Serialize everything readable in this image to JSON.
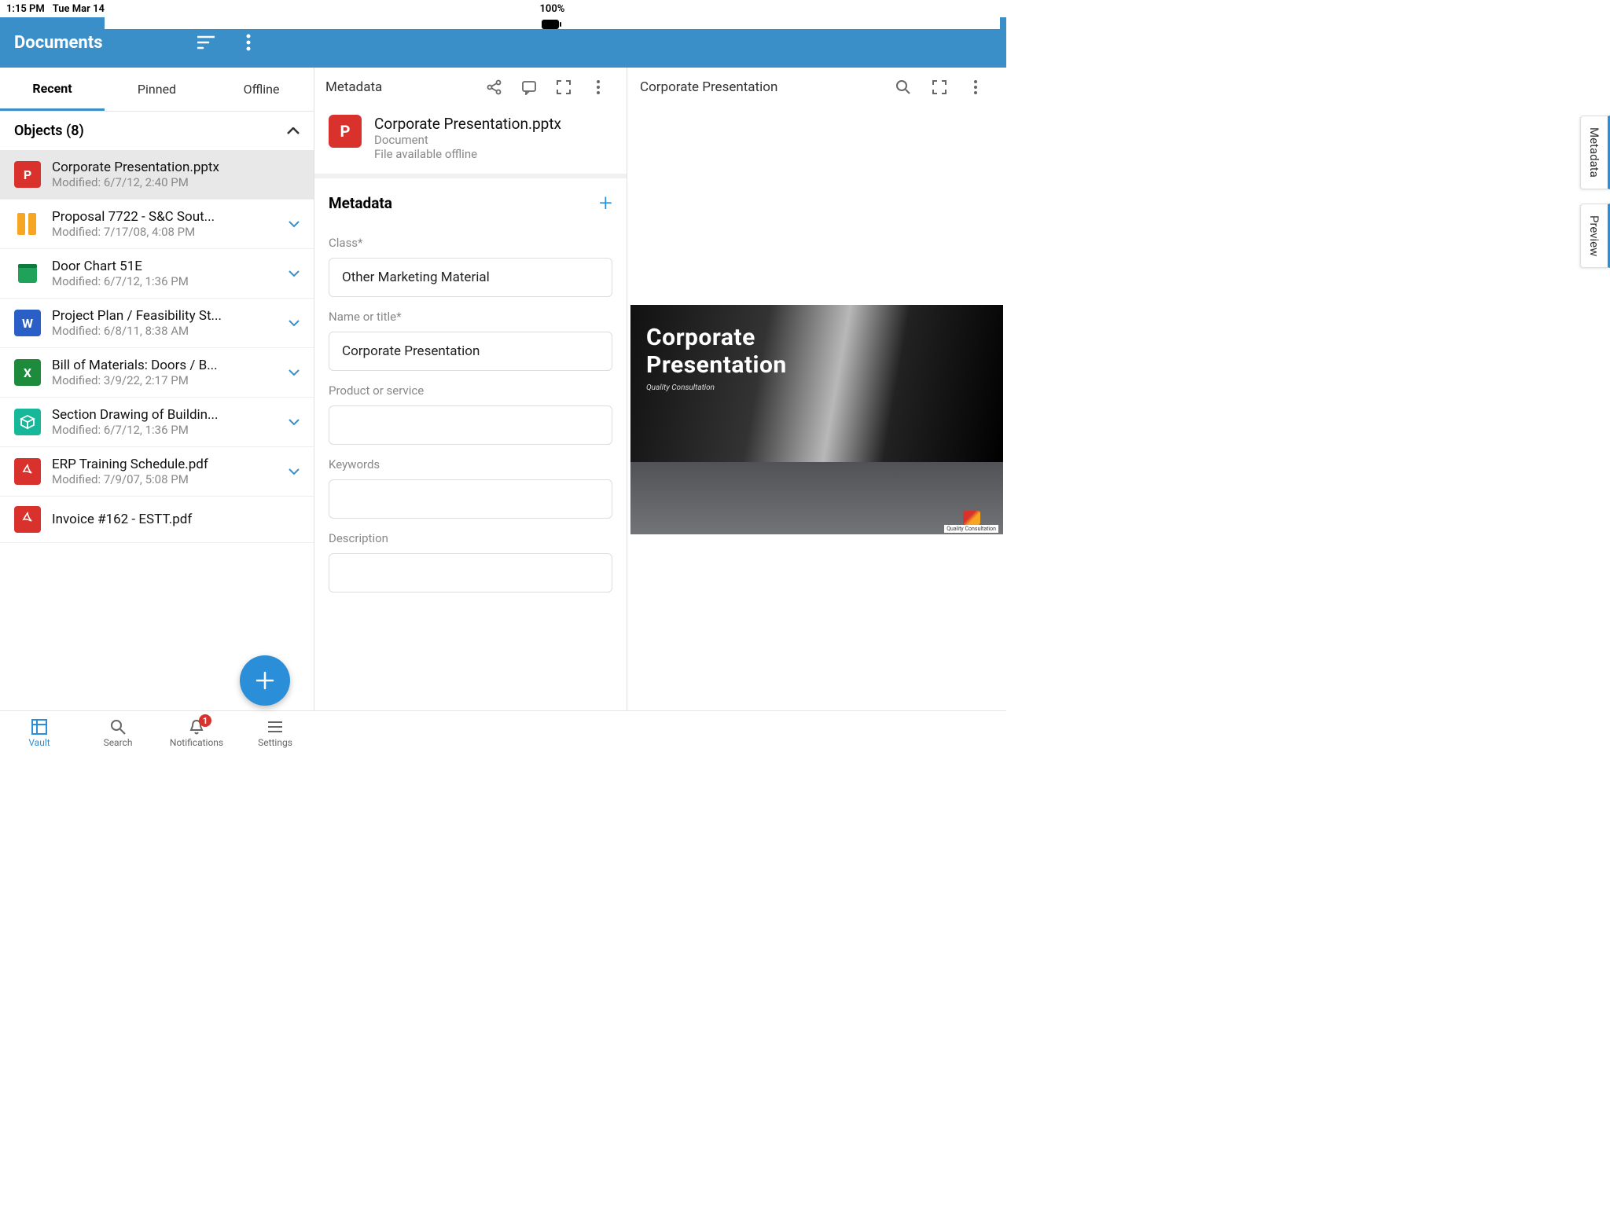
{
  "statusbar": {
    "time": "1:15 PM",
    "date": "Tue Mar 14",
    "battery": "100%"
  },
  "topbar": {
    "title": "Documents"
  },
  "tabs": {
    "recent": "Recent",
    "pinned": "Pinned",
    "offline": "Offline"
  },
  "section": {
    "label": "Objects (8)"
  },
  "items": [
    {
      "name": "Corporate Presentation.pptx",
      "sub": "Modified: 6/7/12, 2:40 PM",
      "icon": "P",
      "color": "#d9322d",
      "selected": true,
      "chev": false
    },
    {
      "name": "Proposal 7722 - S&C Sout...",
      "sub": "Modified: 7/17/08, 4:08 PM",
      "icon": "binder",
      "color": "#f6a623",
      "chev": true
    },
    {
      "name": "Door Chart 51E",
      "sub": "Modified: 6/7/12, 1:36 PM",
      "icon": "book",
      "color": "#1fa35a",
      "chev": true
    },
    {
      "name": "Project Plan / Feasibility St...",
      "sub": "Modified: 6/8/11, 8:38 AM",
      "icon": "W",
      "color": "#2a5fc8",
      "chev": true
    },
    {
      "name": "Bill of Materials: Doors / B...",
      "sub": "Modified: 3/9/22, 2:17 PM",
      "icon": "X",
      "color": "#1d8a3c",
      "chev": true
    },
    {
      "name": "Section Drawing of Buildin...",
      "sub": "Modified: 6/7/12, 1:36 PM",
      "icon": "box",
      "color": "#17b79a",
      "chev": true
    },
    {
      "name": "ERP Training Schedule.pdf",
      "sub": "Modified: 7/9/07, 5:08 PM",
      "icon": "pdf",
      "color": "#d9322d",
      "chev": true
    },
    {
      "name": "Invoice #162 - ESTT.pdf",
      "sub": "",
      "icon": "pdf",
      "color": "#d9322d",
      "chev": false
    }
  ],
  "middle": {
    "toplabel": "Metadata",
    "file": {
      "title": "Corporate Presentation.pptx",
      "type": "Document",
      "status": "File available offline"
    },
    "section_title": "Metadata",
    "fields": {
      "class_label": "Class*",
      "class_value": "Other Marketing Material",
      "name_label": "Name or title*",
      "name_value": "Corporate Presentation",
      "product_label": "Product or service",
      "product_value": "",
      "keywords_label": "Keywords",
      "keywords_value": "",
      "description_label": "Description",
      "description_value": ""
    }
  },
  "right": {
    "title": "Corporate Presentation",
    "slide1_l1": "Corporate",
    "slide1_l2": "Presentation",
    "slide1_sub": "Quality Consultation",
    "slide2_badge": "Quality Consultation"
  },
  "sidetabs": {
    "metadata": "Metadata",
    "preview": "Preview"
  },
  "bottom": {
    "vault": "Vault",
    "search": "Search",
    "notifications": "Notifications",
    "settings": "Settings",
    "badge": "1"
  }
}
